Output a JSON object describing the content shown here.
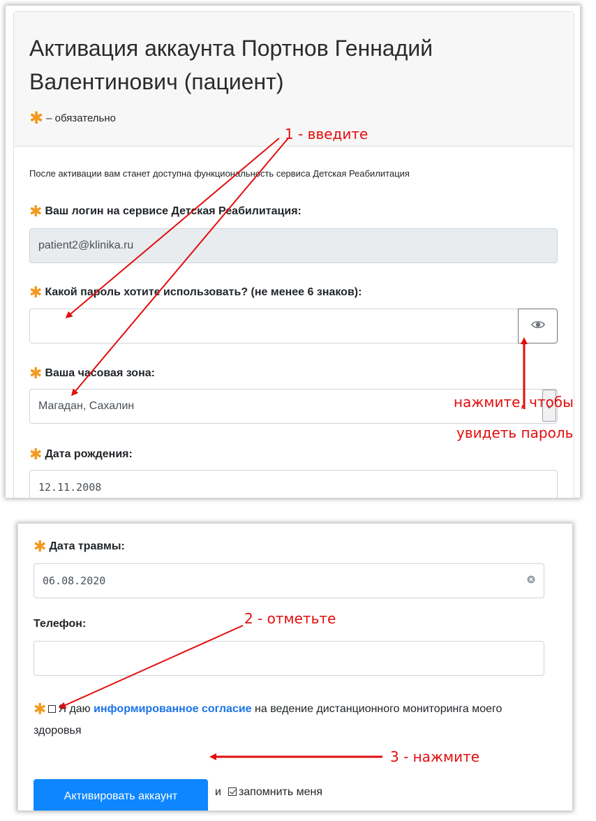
{
  "activation": {
    "title": "Активация аккаунта Портнов Геннадий Валентинович (пациент)",
    "required_note": "– обязательно",
    "intro": "После активации вам станет доступна функциональность сервиса Детская Реабилитация",
    "login_label": "Ваш логин на сервисе Детская Реабилитация:",
    "login_value": "patient2@klinika.ru",
    "password_label": "Какой пароль хотите использовать? (не менее 6 знаков):",
    "password_value": "",
    "timezone_label": "Ваша часовая зона:",
    "timezone_value": "Магадан, Сахалин",
    "birthdate_label": "Дата рождения:",
    "birthdate_value": "12.11.2008",
    "star_glyph": "✱",
    "eye_icon": "eye-icon",
    "select_arrow_glyph": "⌄"
  },
  "activation_bottom": {
    "injury_date_label": "Дата травмы:",
    "injury_date_value": "06.08.2020",
    "clear_icon": "clear-x-icon",
    "phone_label": "Телефон:",
    "phone_value": "",
    "consent_prefix": "Я даю",
    "consent_link": "информированное согласие",
    "consent_suffix": "на ведение дистанционного мониторинга моего здоровья",
    "submit_label": "Активировать аккаунт",
    "remember_prefix": "и",
    "remember_label": "запомнить меня"
  },
  "annotations": {
    "step1": "1 - введите",
    "step2": "2 - отметьте",
    "step3": "3 - нажмите",
    "eye_hint_line1": "нажмите, чтобы",
    "eye_hint_line2": "увидеть пароль",
    "color": "#e20d0d"
  },
  "colors": {
    "required_star": "#f39a1f",
    "primary_button": "#0d86ff",
    "link": "#1a73e8",
    "disabled_input": "#e9ecef"
  }
}
